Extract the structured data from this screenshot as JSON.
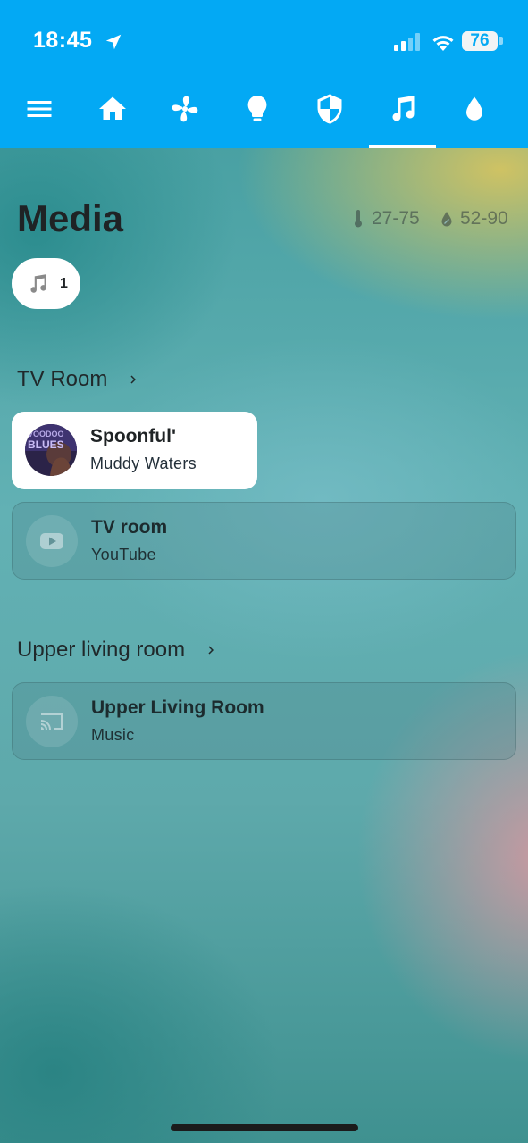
{
  "status_bar": {
    "time": "18:45",
    "battery_level": "76",
    "icons": [
      "location-arrow-icon",
      "signal-icon",
      "wifi-icon",
      "battery-icon"
    ]
  },
  "theme": {
    "header_color": "#03a9f4",
    "card_color": "#ffffff"
  },
  "nav": {
    "icons": [
      "menu-icon",
      "home-icon",
      "fan-icon",
      "lightbulb-icon",
      "shield-icon",
      "music-icon",
      "water-drop-icon"
    ],
    "active_tab": "music-icon"
  },
  "page": {
    "title": "Media",
    "temperature_range": "27-75",
    "humidity_range": "52-90"
  },
  "filter_chip": {
    "icon": "music-icon",
    "count": "1"
  },
  "areas": [
    {
      "name": "TV Room",
      "players": [
        {
          "title": "Spoonful'",
          "subtitle": "Muddy Waters",
          "state": "playing",
          "icon": "album-art"
        },
        {
          "title": "TV room",
          "subtitle": "YouTube",
          "state": "idle",
          "icon": "youtube-icon"
        }
      ]
    },
    {
      "name": "Upper living room",
      "players": [
        {
          "title": "Upper Living Room",
          "subtitle": "Music",
          "state": "idle",
          "icon": "cast-icon"
        }
      ]
    }
  ]
}
